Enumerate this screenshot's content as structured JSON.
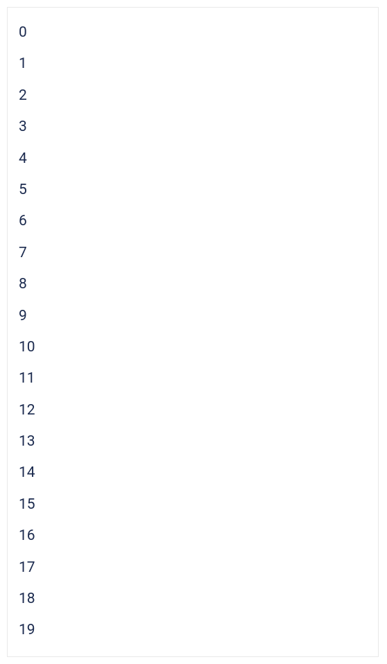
{
  "list": {
    "items": [
      "0",
      "1",
      "2",
      "3",
      "4",
      "5",
      "6",
      "7",
      "8",
      "9",
      "10",
      "11",
      "12",
      "13",
      "14",
      "15",
      "16",
      "17",
      "18",
      "19"
    ]
  }
}
